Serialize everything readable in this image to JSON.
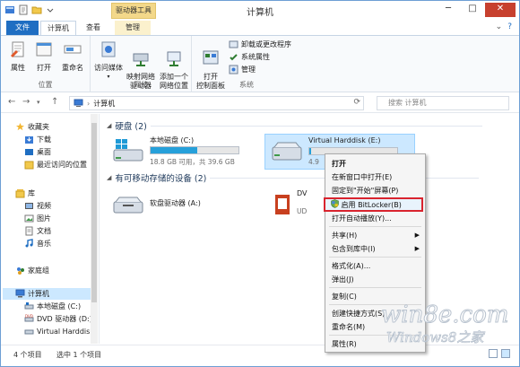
{
  "window": {
    "title": "计算机",
    "contextual_tab_header": "驱动器工具"
  },
  "ribbon_tabs": [
    {
      "label": "文件"
    },
    {
      "label": "计算机"
    },
    {
      "label": "查看"
    },
    {
      "label": "管理"
    }
  ],
  "ribbon": {
    "groups": [
      {
        "label": "位置",
        "buttons": [
          {
            "label": "属性"
          },
          {
            "label": "打开"
          },
          {
            "label": "重命名"
          }
        ]
      },
      {
        "label": "网络",
        "buttons": [
          {
            "label": "访问媒体",
            "dropdown": true
          },
          {
            "label": "映射网络\n驱动器"
          },
          {
            "label": "添加一个\n网络位置"
          }
        ]
      },
      {
        "label": "系统",
        "buttons": [
          {
            "label": "打开\n控制面板"
          }
        ],
        "small_buttons": [
          {
            "label": "卸载或更改程序"
          },
          {
            "label": "系统属性"
          },
          {
            "label": "管理"
          }
        ]
      }
    ]
  },
  "address": {
    "path": "计算机",
    "search_placeholder": "搜索 计算机"
  },
  "nav_pane": {
    "favorites": {
      "label": "收藏夹",
      "items": [
        "下载",
        "桌面",
        "最近访问的位置"
      ]
    },
    "libraries": {
      "label": "库",
      "items": [
        "视频",
        "图片",
        "文档",
        "音乐"
      ]
    },
    "homegroup": {
      "label": "家庭组"
    },
    "computer": {
      "label": "计算机",
      "items": [
        "本地磁盘 (C:)",
        "DVD 驱动器 (D:)",
        "Virtual Harddisk"
      ]
    }
  },
  "content": {
    "hard_disks": {
      "header": "硬盘 (2)",
      "drives": [
        {
          "name": "本地磁盘 (C:)",
          "info": "18.8 GB 可用，共 39.6 GB",
          "used_fraction": 0.53
        },
        {
          "name": "Virtual Harddisk (E:)",
          "info": "4.9",
          "used_fraction": 0.02
        }
      ]
    },
    "removable": {
      "header": "有可移动存储的设备 (2)",
      "devices": [
        {
          "name": "软盘驱动器 (A:)"
        },
        {
          "name": "DV",
          "info": "UD"
        }
      ]
    }
  },
  "context_menu": {
    "items": [
      {
        "label": "打开",
        "bold": true
      },
      {
        "label": "在新窗口中打开(E)"
      },
      {
        "label": "固定到\"开始\"屏幕(P)"
      },
      {
        "label": "启用 BitLocker(B)",
        "highlighted": true
      },
      {
        "label": "打开自动播放(Y)..."
      },
      {
        "label": "共享(H)",
        "submenu": true
      },
      {
        "label": "包含到库中(I)",
        "submenu": true
      },
      {
        "label": "格式化(A)..."
      },
      {
        "label": "弹出(J)"
      },
      {
        "label": "复制(C)"
      },
      {
        "label": "创建快捷方式(S)"
      },
      {
        "label": "重命名(M)"
      },
      {
        "label": "属性(R)"
      }
    ]
  },
  "status_bar": {
    "item_count": "4 个项目",
    "selected_count": "选中 1 个项目"
  },
  "watermark": {
    "brand": "win8e.com",
    "sub": "Windows8之家"
  },
  "colors": {
    "accent": "#1f6ec2",
    "selection": "#cce8ff",
    "highlight_border": "#d9242e",
    "capacity_bar": "#26a0da"
  }
}
